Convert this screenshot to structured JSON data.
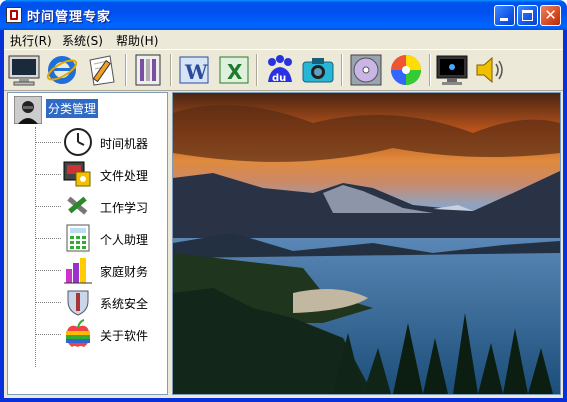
{
  "window": {
    "title": "时间管理专家"
  },
  "menu": [
    {
      "label": "执行(R)"
    },
    {
      "label": "系统(S)"
    },
    {
      "label": "帮助(H)"
    }
  ],
  "toolbar": [
    {
      "icon": "monitor-icon"
    },
    {
      "icon": "internet-explorer-icon"
    },
    {
      "icon": "notepad-pencil-icon"
    },
    {
      "icon": "printer-icon"
    },
    {
      "icon": "word-icon"
    },
    {
      "icon": "excel-icon"
    },
    {
      "icon": "baidu-icon"
    },
    {
      "icon": "camera-icon"
    },
    {
      "icon": "cd-drive-icon"
    },
    {
      "icon": "color-wheel-icon"
    },
    {
      "icon": "screen-icon"
    },
    {
      "icon": "speaker-icon"
    }
  ],
  "tree": {
    "root": {
      "label": "分类管理",
      "icon": "user-icon"
    },
    "items": [
      {
        "label": "时间机器",
        "icon": "clock-icon"
      },
      {
        "label": "文件处理",
        "icon": "file-processing-icon"
      },
      {
        "label": "工作学习",
        "icon": "tools-icon"
      },
      {
        "label": "个人助理",
        "icon": "calculator-icon"
      },
      {
        "label": "家庭财务",
        "icon": "chart-icon"
      },
      {
        "label": "系统安全",
        "icon": "shield-icon"
      },
      {
        "label": "关于软件",
        "icon": "apple-icon"
      }
    ]
  },
  "colors": {
    "titlebar": "#0053ee",
    "selection": "#316ac5",
    "client": "#ece9d8"
  }
}
